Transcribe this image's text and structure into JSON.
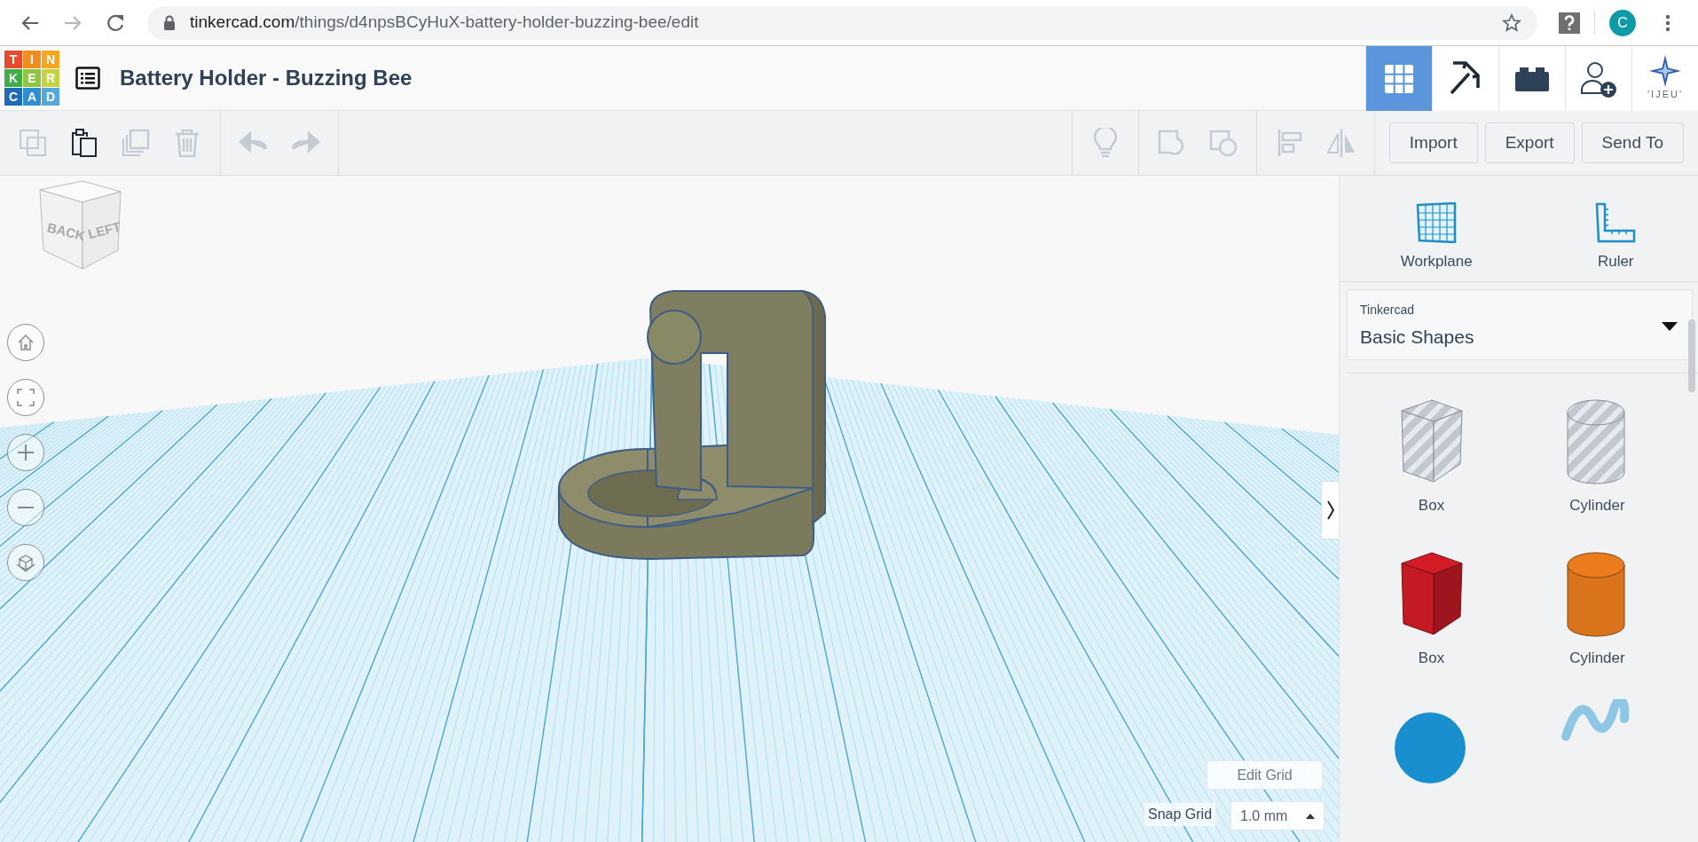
{
  "browser": {
    "url_host": "tinkercad.com",
    "url_path": "/things/d4npsBCyHuX-battery-holder-buzzing-bee/edit",
    "forward_disabled": true,
    "profile_initial": "C"
  },
  "app": {
    "logo": [
      [
        "T",
        "I",
        "N"
      ],
      [
        "K",
        "E",
        "R"
      ],
      [
        "C",
        "A",
        "D"
      ]
    ],
    "title": "Battery Holder - Buzzing Bee"
  },
  "nav_tabs": [
    {
      "kind": "grid",
      "selected": true
    },
    {
      "kind": "pickaxe",
      "selected": false
    },
    {
      "kind": "bricks",
      "selected": false
    },
    {
      "kind": "user-add",
      "selected": false
    },
    {
      "kind": "star",
      "selected": false,
      "label": "'IJEU'"
    }
  ],
  "toolbar": {
    "edit_tools": [
      {
        "kind": "copy",
        "disabled": true
      },
      {
        "kind": "paste",
        "disabled": false
      },
      {
        "kind": "duplicate",
        "disabled": true
      },
      {
        "kind": "delete",
        "disabled": true
      },
      {
        "kind": "undo",
        "disabled": true
      },
      {
        "kind": "redo",
        "disabled": true
      }
    ],
    "shape_tools": [
      {
        "kind": "bulb",
        "disabled": true
      },
      {
        "kind": "group",
        "disabled": true
      },
      {
        "kind": "ungroup",
        "disabled": true
      },
      {
        "kind": "align",
        "disabled": true
      },
      {
        "kind": "mirror",
        "disabled": true
      }
    ],
    "actions": [
      "Import",
      "Export",
      "Send To"
    ]
  },
  "view_cube": {
    "faces": [
      "BACK",
      "LEFT"
    ]
  },
  "panel": {
    "tools": [
      "Workplane",
      "Ruler"
    ],
    "library": {
      "label": "Tinkercad",
      "value": "Basic Shapes"
    },
    "shapes": [
      {
        "kind": "box",
        "label": "Box",
        "hole": true
      },
      {
        "kind": "cylinder",
        "label": "Cylinder",
        "hole": true
      },
      {
        "kind": "box",
        "label": "Box",
        "color": "#c41a24"
      },
      {
        "kind": "cylinder",
        "label": "Cylinder",
        "color": "#d9731c"
      },
      {
        "kind": "sphere",
        "color": "#1a8fcf"
      },
      {
        "kind": "scribble",
        "color": "#8ec6e6"
      }
    ]
  },
  "grid": {
    "edit_button": "Edit Grid",
    "snap_label": "Snap Grid",
    "snap_value": "1.0 mm"
  }
}
